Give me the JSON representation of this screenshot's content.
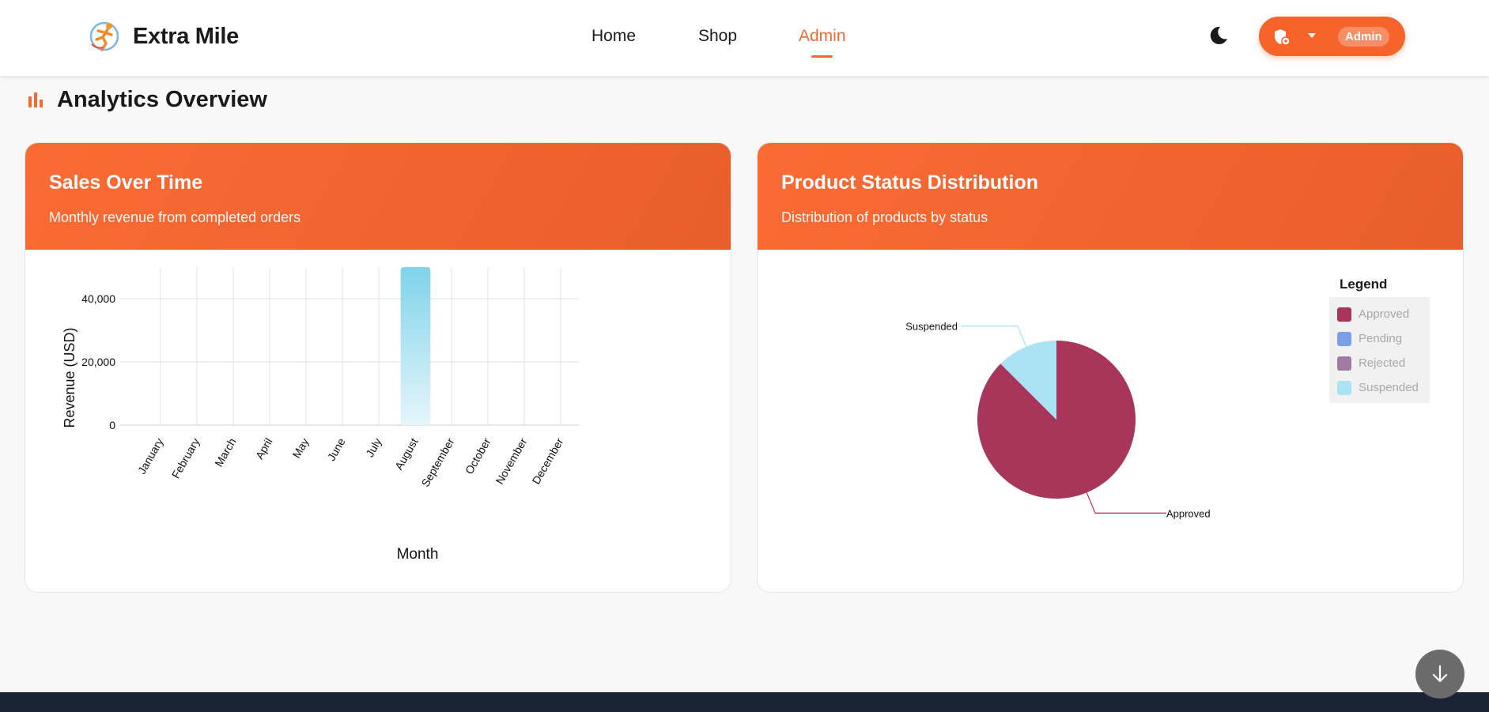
{
  "brand": {
    "name": "Extra Mile"
  },
  "nav": [
    {
      "label": "Home",
      "active": false
    },
    {
      "label": "Shop",
      "active": false
    },
    {
      "label": "Admin",
      "active": true
    }
  ],
  "header_actions": {
    "theme_icon": "moon-icon",
    "user_menu": {
      "icon": "shield-icon",
      "badge": "Admin"
    }
  },
  "section": {
    "title": "Analytics Overview",
    "icon": "bar-chart-icon"
  },
  "sales_card": {
    "title": "Sales Over Time",
    "subtitle": "Monthly revenue from completed orders"
  },
  "status_card": {
    "title": "Product Status Distribution",
    "subtitle": "Distribution of products by status"
  },
  "colors": {
    "accent": "#f26a30",
    "header_gradient_start": "#fb6b34",
    "header_gradient_end": "#e85e2c",
    "bar_top": "#7fd3ea",
    "bar_bottom": "#e6f6fb"
  },
  "chart_data": [
    {
      "type": "bar",
      "categories": [
        "January",
        "February",
        "March",
        "April",
        "May",
        "June",
        "July",
        "August",
        "September",
        "October",
        "November",
        "December"
      ],
      "values": [
        0,
        0,
        0,
        0,
        0,
        0,
        0,
        50000,
        0,
        0,
        0,
        0
      ],
      "xlabel": "Month",
      "ylabel": "Revenue (USD)",
      "ylim": [
        0,
        50000
      ],
      "yticks": [
        0,
        20000,
        40000
      ],
      "ytick_labels": [
        "0",
        "20,000",
        "40,000"
      ],
      "grid": true
    },
    {
      "type": "pie",
      "legend_title": "Legend",
      "legend_position": "right",
      "labels": [
        "Approved",
        "Pending",
        "Rejected",
        "Suspended"
      ],
      "values": [
        87.5,
        0,
        0,
        12.5
      ],
      "colors": [
        "#a8365b",
        "#7b9ee8",
        "#a07ca3",
        "#abe3f5"
      ],
      "slice_labels": [
        "Approved",
        "Suspended"
      ]
    }
  ],
  "scroll_button": {
    "icon": "arrow-down-icon"
  }
}
